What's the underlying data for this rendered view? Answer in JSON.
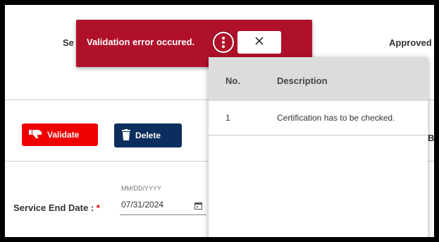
{
  "header": {
    "col1_partial": "Se",
    "col2": "Approved"
  },
  "toolbar": {
    "validate_label": "Validate",
    "delete_label": "Delete",
    "by_partial": "By"
  },
  "form": {
    "service_end_date_label": "Service End Date :",
    "required_mark": "*",
    "date_hint": "MM/DD/YYYY",
    "date_value": "07/31/2024"
  },
  "toast": {
    "message": "Validation error occured."
  },
  "errors_table": {
    "columns": [
      "No.",
      "Description"
    ],
    "rows": [
      {
        "no": "1",
        "description": "Certification has to be checked."
      }
    ]
  },
  "colors": {
    "toast_bg": "#b0112a",
    "validate_bg": "#ee0000",
    "delete_bg": "#0b2e5e"
  },
  "icons": [
    "thumbs-down-icon",
    "trash-icon",
    "more-vert-icon",
    "close-icon",
    "calendar-icon"
  ]
}
